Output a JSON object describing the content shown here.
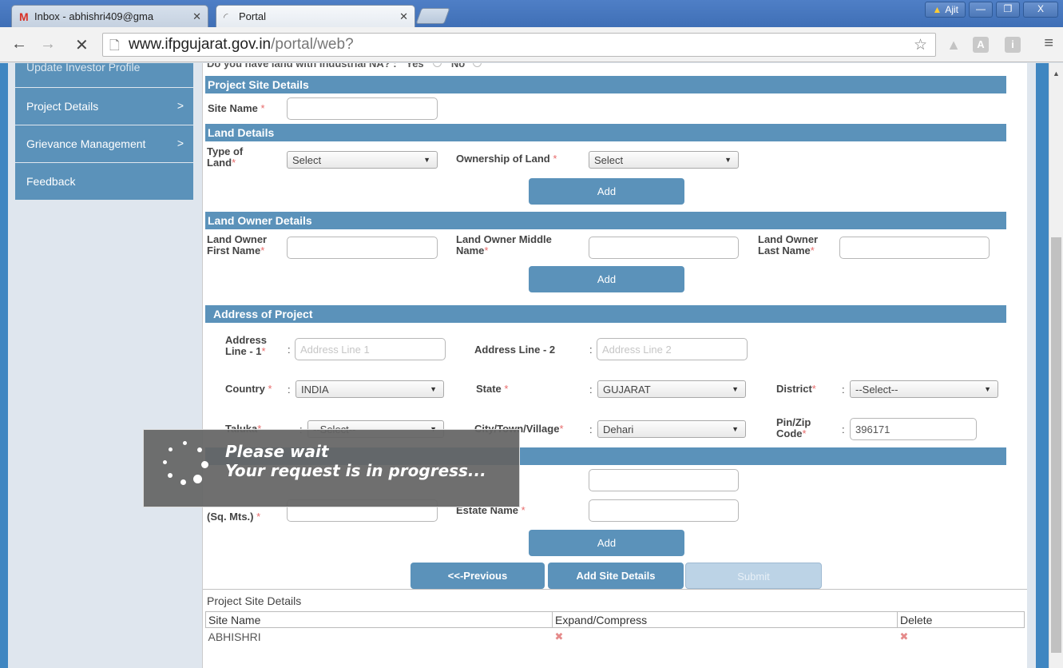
{
  "browser": {
    "tabs": [
      {
        "label": "Inbox - abhishri409@gma",
        "icon": "gmail-icon",
        "active": false
      },
      {
        "label": "Portal",
        "icon": "loading-icon",
        "active": true
      }
    ],
    "user_label": "Ajit",
    "url_host": "www.ifpgujarat.gov.in",
    "url_path": "/portal/web?",
    "ext_a": "A",
    "ext_i": "i"
  },
  "sidebar": {
    "items": [
      {
        "label": "Update Investor Profile"
      },
      {
        "label": "Project Details",
        "chevron": ">"
      },
      {
        "label": "Grievance Management",
        "chevron": ">"
      },
      {
        "label": "Feedback"
      }
    ]
  },
  "form": {
    "industrial_na_question": "Do you have land with Industrial NA? :",
    "industrial_na_yes": "Yes",
    "industrial_na_no": "No",
    "project_site_section": "Project Site Details",
    "site_name_label": "Site Name",
    "land_details_section": "Land Details",
    "type_of_land_label": "Type of Land",
    "type_of_land_value": "Select",
    "ownership_label": "Ownership of Land",
    "ownership_value": "Select",
    "add_label": "Add",
    "land_owner_section": "Land Owner Details",
    "owner_first_label": "Land Owner First Name",
    "owner_middle_label": "Land Owner Middle Name",
    "owner_last_label": "Land Owner Last Name",
    "address_section": "Address of Project",
    "address1_label": "Address Line - 1",
    "address1_placeholder": "Address Line 1",
    "address2_label": "Address Line - 2",
    "address2_placeholder": "Address Line 2",
    "country_label": "Country",
    "country_value": "INDIA",
    "state_label": "State",
    "state_value": "GUJARAT",
    "district_label": "District",
    "district_value": "--Select--",
    "taluka_label": "Taluka",
    "taluka_value": "--Select--",
    "city_label": "City/Town/Village",
    "city_value": "Dehari",
    "pin_label": "Pin/Zip Code",
    "pin_value": "396171",
    "sqmts_label": "(Sq. Mts.)",
    "estate_label": "Estate Name",
    "colon": ":",
    "required_mark": "*",
    "prev_button": "<<-Previous",
    "add_site_button": "Add Site Details",
    "submit_button": "Submit"
  },
  "grid": {
    "caption": "Project Site Details",
    "columns": [
      "Site Name",
      "Expand/Compress",
      "Delete"
    ],
    "rows": [
      {
        "site_name": "ABHISHRI"
      }
    ]
  },
  "loading": {
    "line1": "Please wait",
    "line2": "Your request is in progress..."
  }
}
